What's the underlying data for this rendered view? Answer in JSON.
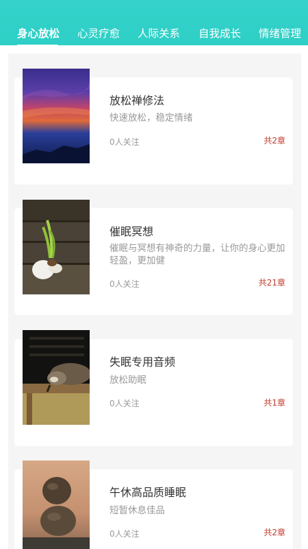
{
  "tabs": [
    {
      "label": "身心放松",
      "active": true
    },
    {
      "label": "心灵疗愈",
      "active": false
    },
    {
      "label": "人际关系",
      "active": false
    },
    {
      "label": "自我成长",
      "active": false
    },
    {
      "label": "情绪管理",
      "active": false
    }
  ],
  "colors": {
    "header": "#2ecfc6",
    "chapter_count": "#c0392b",
    "panel_background": "#f5f5f5"
  },
  "courses": [
    {
      "title": "放松禅修法",
      "description": "快速放松，稳定情绪",
      "followers": "0人关注",
      "chapters": "共2章",
      "image": "sunset-sky"
    },
    {
      "title": "催眠冥想",
      "description": "催眠与冥想有神奇的力量，让你的身心更加轻盈，更加健",
      "followers": "0人关注",
      "chapters": "共21章",
      "image": "sprout-in-eggshell"
    },
    {
      "title": "失眠专用音频",
      "description": "放松助眠",
      "followers": "0人关注",
      "chapters": "共1章",
      "image": "sleeping-raccoon"
    },
    {
      "title": "午休高品质睡眠",
      "description": "短暂休息佳品",
      "followers": "0人关注",
      "chapters": "共2章",
      "image": "stacked-stones"
    }
  ]
}
